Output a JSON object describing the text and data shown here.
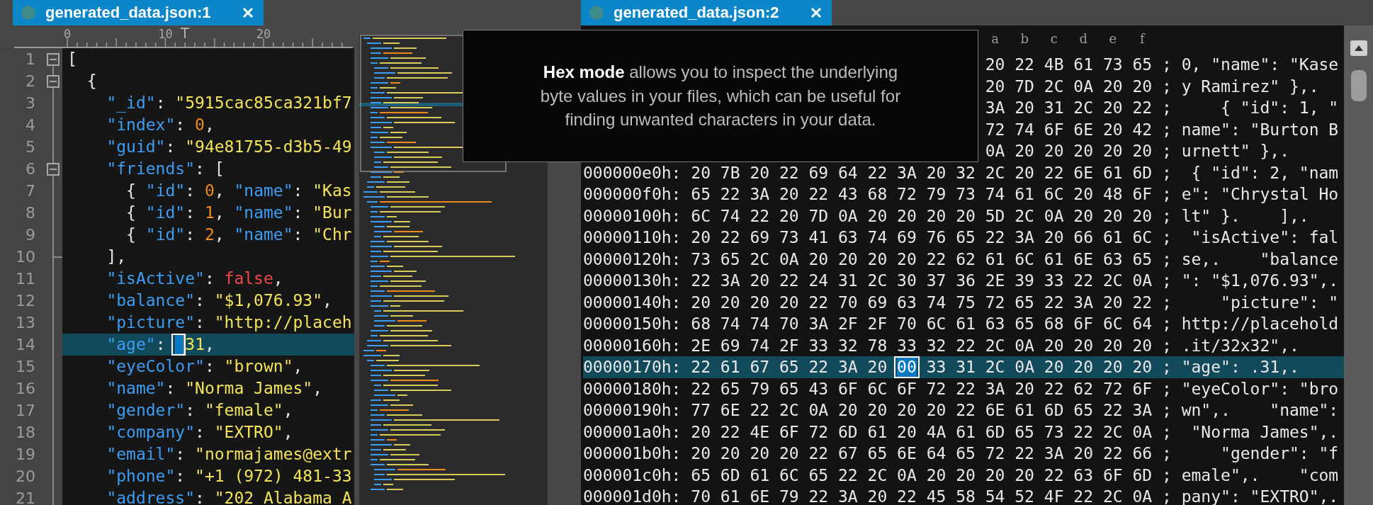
{
  "left_pane": {
    "tab": {
      "title": "generated_data.json:1",
      "selected": true
    },
    "ruler": {
      "labels": [
        "0",
        "10",
        "20"
      ]
    },
    "lines": [
      {
        "number": "1",
        "kind": "fold_start",
        "current": false,
        "tokens": [
          {
            "kind": "punct",
            "text": "["
          }
        ]
      },
      {
        "number": "2",
        "kind": "fold_start",
        "current": false,
        "tokens": [
          {
            "kind": "punct",
            "text": "  {"
          }
        ]
      },
      {
        "number": "3",
        "current": false,
        "tokens": [
          {
            "kind": "key",
            "text": "    \"_id\""
          },
          {
            "kind": "punct",
            "text": ": "
          },
          {
            "kind": "string",
            "text": "\"5915cac85ca321bf7"
          }
        ]
      },
      {
        "number": "4",
        "current": false,
        "tokens": [
          {
            "kind": "key",
            "text": "    \"index\""
          },
          {
            "kind": "punct",
            "text": ": "
          },
          {
            "kind": "number",
            "text": "0"
          },
          {
            "kind": "punct",
            "text": ","
          }
        ]
      },
      {
        "number": "5",
        "current": false,
        "tokens": [
          {
            "kind": "key",
            "text": "    \"guid\""
          },
          {
            "kind": "punct",
            "text": ": "
          },
          {
            "kind": "string",
            "text": "\"94e81755-d3b5-49"
          }
        ]
      },
      {
        "number": "6",
        "kind": "fold_start",
        "current": false,
        "tokens": [
          {
            "kind": "key",
            "text": "    \"friends\""
          },
          {
            "kind": "punct",
            "text": ": ["
          }
        ]
      },
      {
        "number": "7",
        "current": false,
        "tokens": [
          {
            "kind": "punct",
            "text": "      { "
          },
          {
            "kind": "key",
            "text": "\"id\""
          },
          {
            "kind": "punct",
            "text": ": "
          },
          {
            "kind": "number",
            "text": "0"
          },
          {
            "kind": "punct",
            "text": ", "
          },
          {
            "kind": "key",
            "text": "\"name\""
          },
          {
            "kind": "punct",
            "text": ": "
          },
          {
            "kind": "string",
            "text": "\"Kas"
          }
        ]
      },
      {
        "number": "8",
        "current": false,
        "tokens": [
          {
            "kind": "punct",
            "text": "      { "
          },
          {
            "kind": "key",
            "text": "\"id\""
          },
          {
            "kind": "punct",
            "text": ": "
          },
          {
            "kind": "number",
            "text": "1"
          },
          {
            "kind": "punct",
            "text": ", "
          },
          {
            "kind": "key",
            "text": "\"name\""
          },
          {
            "kind": "punct",
            "text": ": "
          },
          {
            "kind": "string",
            "text": "\"Bur"
          }
        ]
      },
      {
        "number": "9",
        "current": false,
        "tokens": [
          {
            "kind": "punct",
            "text": "      { "
          },
          {
            "kind": "key",
            "text": "\"id\""
          },
          {
            "kind": "punct",
            "text": ": "
          },
          {
            "kind": "number",
            "text": "2"
          },
          {
            "kind": "punct",
            "text": ", "
          },
          {
            "kind": "key",
            "text": "\"name\""
          },
          {
            "kind": "punct",
            "text": ": "
          },
          {
            "kind": "string",
            "text": "\"Chr"
          }
        ]
      },
      {
        "number": "10",
        "kind": "fold_end",
        "current": false,
        "tokens": [
          {
            "kind": "punct",
            "text": "    ],"
          }
        ]
      },
      {
        "number": "11",
        "current": false,
        "tokens": [
          {
            "kind": "key",
            "text": "    \"isActive\""
          },
          {
            "kind": "punct",
            "text": ": "
          },
          {
            "kind": "bool",
            "text": "false"
          },
          {
            "kind": "punct",
            "text": ","
          }
        ]
      },
      {
        "number": "12",
        "current": false,
        "tokens": [
          {
            "kind": "key",
            "text": "    \"balance\""
          },
          {
            "kind": "punct",
            "text": ": "
          },
          {
            "kind": "string",
            "text": "\"$1,076.93\""
          },
          {
            "kind": "punct",
            "text": ","
          }
        ]
      },
      {
        "number": "13",
        "current": false,
        "tokens": [
          {
            "kind": "key",
            "text": "    \"picture\""
          },
          {
            "kind": "punct",
            "text": ": "
          },
          {
            "kind": "string",
            "text": "\"http://placeh"
          }
        ]
      },
      {
        "number": "14",
        "current": true,
        "tokens": [
          {
            "kind": "key",
            "text": "    \"age\""
          },
          {
            "kind": "punct",
            "text": ": "
          },
          {
            "kind": "null"
          },
          {
            "kind": "string",
            "text": "31"
          },
          {
            "kind": "punct",
            "text": ","
          }
        ]
      },
      {
        "number": "15",
        "current": false,
        "tokens": [
          {
            "kind": "key",
            "text": "    \"eyeColor\""
          },
          {
            "kind": "punct",
            "text": ": "
          },
          {
            "kind": "string",
            "text": "\"brown\""
          },
          {
            "kind": "punct",
            "text": ","
          }
        ]
      },
      {
        "number": "16",
        "current": false,
        "tokens": [
          {
            "kind": "key",
            "text": "    \"name\""
          },
          {
            "kind": "punct",
            "text": ": "
          },
          {
            "kind": "string",
            "text": "\"Norma James\""
          },
          {
            "kind": "punct",
            "text": ","
          }
        ]
      },
      {
        "number": "17",
        "current": false,
        "tokens": [
          {
            "kind": "key",
            "text": "    \"gender\""
          },
          {
            "kind": "punct",
            "text": ": "
          },
          {
            "kind": "string",
            "text": "\"female\""
          },
          {
            "kind": "punct",
            "text": ","
          }
        ]
      },
      {
        "number": "18",
        "current": false,
        "tokens": [
          {
            "kind": "key",
            "text": "    \"company\""
          },
          {
            "kind": "punct",
            "text": ": "
          },
          {
            "kind": "string",
            "text": "\"EXTRO\""
          },
          {
            "kind": "punct",
            "text": ","
          }
        ]
      },
      {
        "number": "19",
        "current": false,
        "tokens": [
          {
            "kind": "key",
            "text": "    \"email\""
          },
          {
            "kind": "punct",
            "text": ": "
          },
          {
            "kind": "string",
            "text": "\"normajames@extr"
          }
        ]
      },
      {
        "number": "20",
        "current": false,
        "tokens": [
          {
            "kind": "key",
            "text": "    \"phone\""
          },
          {
            "kind": "punct",
            "text": ": "
          },
          {
            "kind": "string",
            "text": "\"+1 (972) 481-33"
          }
        ]
      },
      {
        "number": "21",
        "current": false,
        "tokens": [
          {
            "kind": "key",
            "text": "    \"address\""
          },
          {
            "kind": "punct",
            "text": ": "
          },
          {
            "kind": "string",
            "text": "\"202 Alabama A"
          }
        ]
      }
    ]
  },
  "right_pane": {
    "tab": {
      "title": "generated_data.json:2",
      "selected": true
    },
    "column_headers": [
      "a",
      "b",
      "c",
      "d",
      "e",
      "f"
    ],
    "rows": [
      {
        "bytes": "20 22 4B 61 73 65",
        "ascii": "; 0, \"name\": \"Kase",
        "current": false
      },
      {
        "bytes": "20 7D 2C 0A 20 20",
        "ascii": "; y Ramirez\" },.",
        "current": false
      },
      {
        "bytes": "3A 20 31 2C 20 22",
        "ascii": ";     { \"id\": 1, \"",
        "current": false
      },
      {
        "bytes": "72 74 6F 6E 20 42",
        "ascii": "; name\": \"Burton B",
        "current": false
      },
      {
        "bytes": "0A 20 20 20 20 20",
        "ascii": "; urnett\" },.",
        "current": false
      },
      {
        "offset": "000000e0h:",
        "bytes": "20 7B 20 22 69 64 22 3A 20 32 2C 20 22 6E 61 6D",
        "ascii": ";  { \"id\": 2, \"nam",
        "current": false
      },
      {
        "offset": "000000f0h:",
        "bytes": "65 22 3A 20 22 43 68 72 79 73 74 61 6C 20 48 6F",
        "ascii": "; e\": \"Chrystal Ho",
        "current": false
      },
      {
        "offset": "00000100h:",
        "bytes": "6C 74 22 20 7D 0A 20 20 20 20 5D 2C 0A 20 20 20",
        "ascii": "; lt\" }.    ],.",
        "current": false
      },
      {
        "offset": "00000110h:",
        "bytes": "20 22 69 73 41 63 74 69 76 65 22 3A 20 66 61 6C",
        "ascii": ";  \"isActive\": fal",
        "current": false
      },
      {
        "offset": "00000120h:",
        "bytes": "73 65 2C 0A 20 20 20 20 22 62 61 6C 61 6E 63 65",
        "ascii": "; se,.    \"balance",
        "current": false
      },
      {
        "offset": "00000130h:",
        "bytes": "22 3A 20 22 24 31 2C 30 37 36 2E 39 33 22 2C 0A",
        "ascii": "; \": \"$1,076.93\",.",
        "current": false
      },
      {
        "offset": "00000140h:",
        "bytes": "20 20 20 20 22 70 69 63 74 75 72 65 22 3A 20 22",
        "ascii": ";     \"picture\": \"",
        "current": false
      },
      {
        "offset": "00000150h:",
        "bytes": "68 74 74 70 3A 2F 2F 70 6C 61 63 65 68 6F 6C 64",
        "ascii": "; http://placehold",
        "current": false
      },
      {
        "offset": "00000160h:",
        "bytes": "2E 69 74 2F 33 32 78 33 32 22 2C 0A 20 20 20 20",
        "ascii": "; .it/32x32\",.",
        "current": false
      },
      {
        "offset": "00000170h:",
        "bytes": "22 61 67 65 22 3A 20",
        "selected_byte": "00",
        "bytes_after": "33 31 2C 0A 20 20 20 20",
        "ascii": "; \"age\": .31,.",
        "current": true
      },
      {
        "offset": "00000180h:",
        "bytes": "22 65 79 65 43 6F 6C 6F 72 22 3A 20 22 62 72 6F",
        "ascii": "; \"eyeColor\": \"bro",
        "current": false
      },
      {
        "offset": "00000190h:",
        "bytes": "77 6E 22 2C 0A 20 20 20 20 22 6E 61 6D 65 22 3A",
        "ascii": "; wn\",.    \"name\":",
        "current": false
      },
      {
        "offset": "000001a0h:",
        "bytes": "20 22 4E 6F 72 6D 61 20 4A 61 6D 65 73 22 2C 0A",
        "ascii": ";  \"Norma James\",.",
        "current": false
      },
      {
        "offset": "000001b0h:",
        "bytes": "20 20 20 20 22 67 65 6E 64 65 72 22 3A 20 22 66",
        "ascii": ";     \"gender\": \"f",
        "current": false
      },
      {
        "offset": "000001c0h:",
        "bytes": "65 6D 61 6C 65 22 2C 0A 20 20 20 20 22 63 6F 6D",
        "ascii": "; emale\",.    \"com",
        "current": false
      },
      {
        "offset": "000001d0h:",
        "bytes": "70 61 6E 79 22 3A 20 22 45 58 54 52 4F 22 2C 0A",
        "ascii": "; pany\": \"EXTRO\",.",
        "current": false
      }
    ]
  },
  "tooltip": {
    "text": "**Hex mode** allows you to inspect the underlying\nbyte values in your files, which can be useful for\nfinding unwanted characters in your data."
  }
}
